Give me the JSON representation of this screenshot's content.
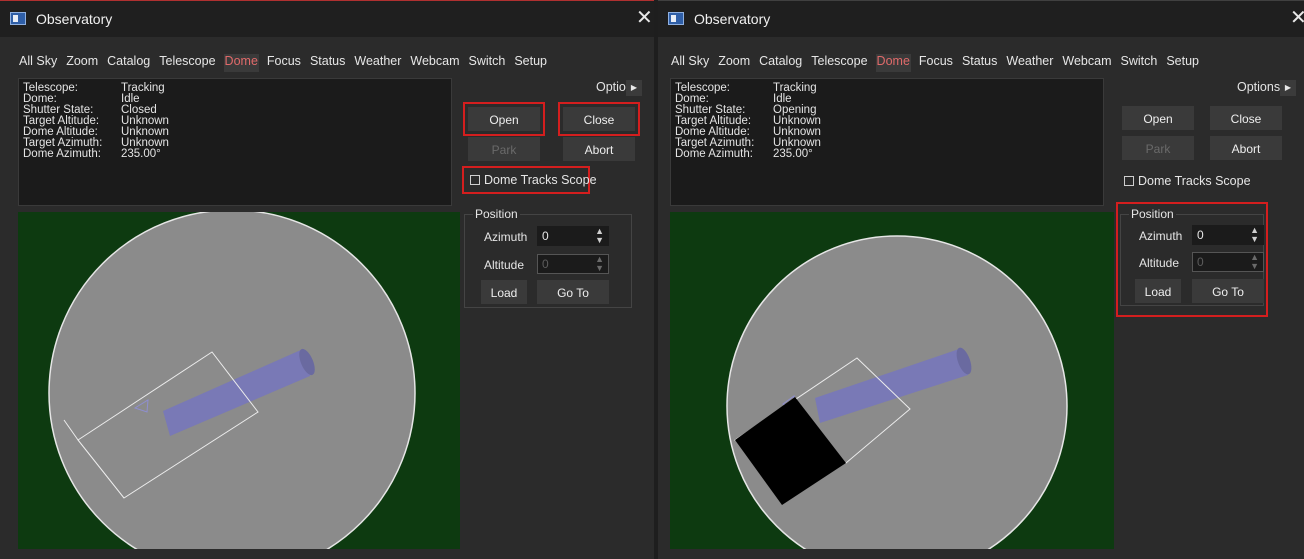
{
  "colors": {
    "accent_tab": "#e06a6a",
    "highlight": "#d41e1e",
    "viewport_bg": "#0d3a10",
    "dome": "#8a8a8a",
    "telescope": "#7878b8"
  },
  "windows": [
    {
      "title": "Observatory",
      "tabs": [
        "All Sky",
        "Zoom",
        "Catalog",
        "Telescope",
        "Dome",
        "Focus",
        "Status",
        "Weather",
        "Webcam",
        "Switch",
        "Setup"
      ],
      "active_tab": "Dome",
      "status": [
        {
          "label": "Telescope:",
          "value": "Tracking"
        },
        {
          "label": "Dome:",
          "value": "Idle"
        },
        {
          "label": "Shutter State:",
          "value": "Closed"
        },
        {
          "label": "Target Altitude:",
          "value": "Unknown"
        },
        {
          "label": "Dome Altitude:",
          "value": "Unknown"
        },
        {
          "label": "Target Azimuth:",
          "value": "Unknown"
        },
        {
          "label": "Dome Azimuth:",
          "value": "235.00°"
        }
      ],
      "options_label": "Options",
      "buttons": {
        "open": "Open",
        "close": "Close",
        "park": "Park",
        "abort": "Abort"
      },
      "dome_tracks_scope": "Dome Tracks Scope",
      "position": {
        "group": "Position",
        "azimuth_label": "Azimuth",
        "azimuth_value": "0",
        "altitude_label": "Altitude",
        "altitude_value": "0",
        "load": "Load",
        "goto": "Go To"
      }
    },
    {
      "title": "Observatory",
      "tabs": [
        "All Sky",
        "Zoom",
        "Catalog",
        "Telescope",
        "Dome",
        "Focus",
        "Status",
        "Weather",
        "Webcam",
        "Switch",
        "Setup"
      ],
      "active_tab": "Dome",
      "status": [
        {
          "label": "Telescope:",
          "value": "Tracking"
        },
        {
          "label": "Dome:",
          "value": "Idle"
        },
        {
          "label": "Shutter State:",
          "value": "Opening"
        },
        {
          "label": "Target Altitude:",
          "value": "Unknown"
        },
        {
          "label": "Dome Altitude:",
          "value": "Unknown"
        },
        {
          "label": "Target Azimuth:",
          "value": "Unknown"
        },
        {
          "label": "Dome Azimuth:",
          "value": "235.00°"
        }
      ],
      "options_label": "Options",
      "buttons": {
        "open": "Open",
        "close": "Close",
        "park": "Park",
        "abort": "Abort"
      },
      "dome_tracks_scope": "Dome Tracks Scope",
      "position": {
        "group": "Position",
        "azimuth_label": "Azimuth",
        "azimuth_value": "0",
        "altitude_label": "Altitude",
        "altitude_value": "0",
        "load": "Load",
        "goto": "Go To"
      }
    }
  ]
}
